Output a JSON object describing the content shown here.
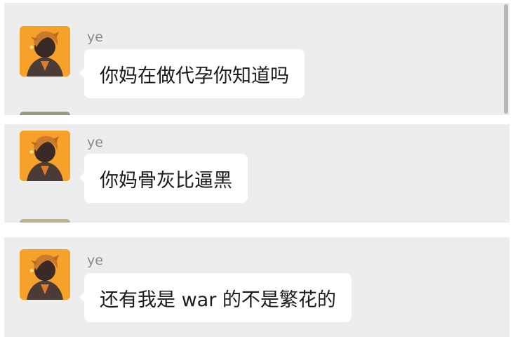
{
  "messages": [
    {
      "sender": "ye",
      "text": "你妈在做代孕你知道吗",
      "avatar_icon": "cartoon-boy-avatar-icon"
    },
    {
      "sender": "ye",
      "text": "你妈骨灰比逼黑",
      "avatar_icon": "cartoon-boy-avatar-icon"
    },
    {
      "sender": "ye",
      "text": "还有我是 war 的不是繁花的",
      "avatar_icon": "cartoon-boy-avatar-icon"
    }
  ],
  "colors": {
    "panel_bg": "#ededed",
    "bubble_bg": "#ffffff",
    "avatar_bg": "#f6a12a",
    "sender_text": "#8a8a8a",
    "message_text": "#1a1a1a"
  }
}
